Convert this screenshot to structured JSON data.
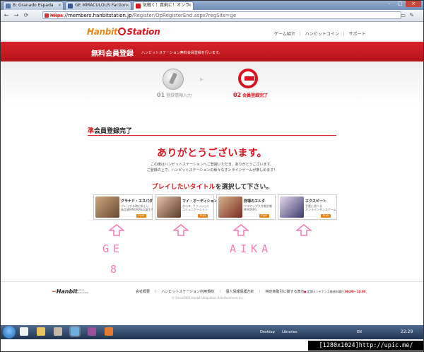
{
  "browser": {
    "tabs": [
      {
        "label": "B: Granado Espada",
        "active": false
      },
      {
        "label": "GE MIRACULOUS Faction",
        "active": false
      },
      {
        "label": "気軽く！真剣に！オンラ",
        "active": true
      }
    ],
    "window_controls": [
      "–",
      "□",
      "×"
    ],
    "nav": {
      "back": "←",
      "forward": "→",
      "reload": "⟳"
    },
    "address": {
      "scheme": "https",
      "separator": "://",
      "host": "members.hanbitstation.jp",
      "path": "/Register/OpRegisterEnd.aspx?regSite=ge"
    },
    "page_menu_icon": "page-icon",
    "wrench_icon": "wrench-icon"
  },
  "site": {
    "logo": {
      "part1": "Hanbit",
      "part2": "Station"
    },
    "topnav": [
      "ゲーム紹介",
      "｜",
      "ハンビットコイン",
      "｜",
      "サポート"
    ],
    "banner": {
      "title": "無料会員登録",
      "description": "ハンビットステーション無料会員登録を行います。"
    },
    "steps": [
      {
        "num": "01",
        "label": "登録情報入力",
        "state": "done"
      },
      {
        "num": "02",
        "label": "会員登録完了",
        "state": "current"
      }
    ],
    "section_title": {
      "prefix": "準",
      "rest": "会員登録完了"
    },
    "thanks": "ありがとうございます。",
    "body_lines": [
      "この度はハンビットステーションへご登録いただき、ありがとうございます。",
      "ご登録の上で、ハンビットステーションの様々なオンラインゲームが楽しめます！"
    ],
    "prompt": {
      "em": "プレイしたいタイトル",
      "rest": "を選択して下さい。"
    },
    "games": [
      {
        "name": "グラナド・エスパダ",
        "desc1": "プレイする時に新しい",
        "desc2": "高品質MMORPGの誕生!!",
        "badge": "PLAY",
        "color_a": "#c9a67a",
        "color_b": "#6a4a35"
      },
      {
        "name": "マイ・オーディション",
        "desc1": "ダンス, ファッション",
        "desc2": "コミュニケーション",
        "badge": "PLAY",
        "color_a": "#e3c3a8",
        "color_b": "#5b3a2a"
      },
      {
        "name": "狩場のエルタ",
        "desc1": "フルアップ大作戦対戦",
        "desc2": "MMORPG",
        "badge": "PLAY",
        "color_a": "#d7b38a",
        "color_b": "#7a2b23"
      },
      {
        "name": "エクスピート",
        "desc1": "手軽に遊べる",
        "desc2": "オンラインダンスゲーム",
        "badge": "PLAY",
        "color_a": "#e6d7ee",
        "color_b": "#3a3a6a"
      }
    ],
    "annotations": {
      "left": "GE",
      "left_sub": "8",
      "right": "AIKA",
      "color": "#ec7fb6"
    },
    "footer": {
      "logo": "Hanbit",
      "logo_sub": [
        "Ubiquitous",
        "Entertainment"
      ],
      "links": [
        "会社概要",
        "｜",
        "ハンビットステーション利用規約",
        "｜",
        "個人情報保護方針",
        "｜",
        "特定商取引に関する表示"
      ],
      "copyright": "© Since2005 Hanbit Ubiquitous Entertainment Inc.",
      "maintenance": {
        "bullet": "●",
        "text": "定期メンテナンス毎週水曜日",
        "time": "09:00〜13:00"
      }
    }
  },
  "taskbar": {
    "desktop_label": "Desktop",
    "libraries_label": "Libraries",
    "lang": "EN",
    "clock": "22:29"
  },
  "watermark": "[1280x1024]http://upic.me/",
  "colors": {
    "brand_red": "#d9141e",
    "brand_orange": "#e8861a"
  }
}
